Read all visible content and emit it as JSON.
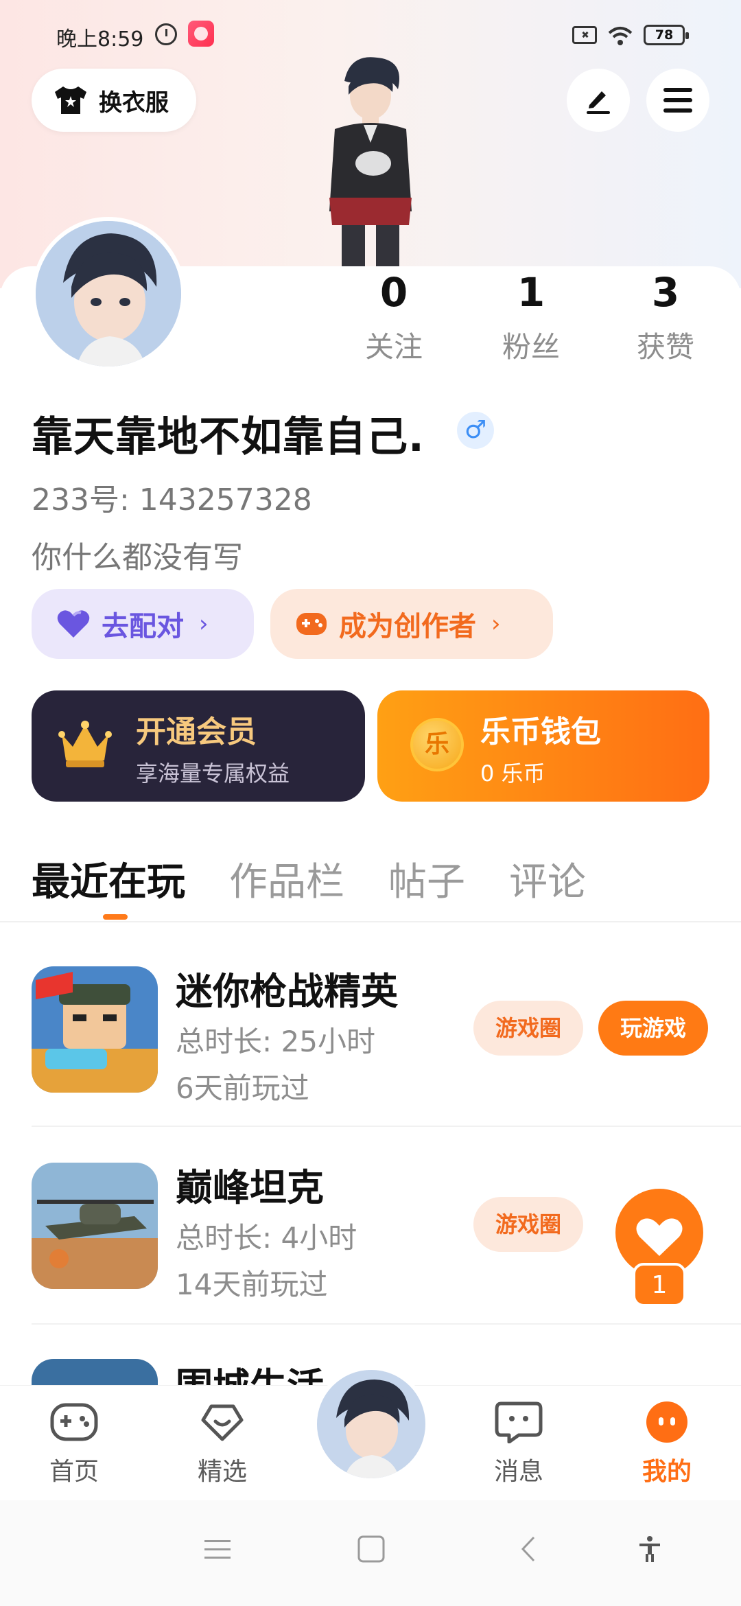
{
  "status_bar": {
    "time": "晚上8:59",
    "battery": "78"
  },
  "header": {
    "outfit_label": "换衣服"
  },
  "profile": {
    "stats": [
      {
        "value": "0",
        "label": "关注"
      },
      {
        "value": "1",
        "label": "粉丝"
      },
      {
        "value": "3",
        "label": "获赞"
      }
    ],
    "username": "靠天靠地不如靠自己.",
    "gender_symbol": "♂",
    "uid": "233号: 143257328",
    "bio": "你什么都没有写"
  },
  "pills": {
    "match": "去配对",
    "creator": "成为创作者",
    "chevron": "›"
  },
  "cards": {
    "vip": {
      "title": "开通会员",
      "subtitle": "享海量专属权益"
    },
    "wallet": {
      "title": "乐币钱包",
      "subtitle": "0 乐币",
      "coin_glyph": "乐"
    }
  },
  "tabs": [
    "最近在玩",
    "作品栏",
    "帖子",
    "评论"
  ],
  "games": [
    {
      "name": "迷你枪战精英",
      "duration": "总时长: 25小时",
      "last_played": "6天前玩过",
      "circle_label": "游戏圈",
      "play_label": "玩游戏"
    },
    {
      "name": "巅峰坦克",
      "duration": "总时长: 4小时",
      "last_played": "14天前玩过",
      "circle_label": "游戏圈"
    },
    {
      "name": "围城生活"
    }
  ],
  "like_badge": {
    "count": "1"
  },
  "bottom_nav": [
    {
      "label": "首页"
    },
    {
      "label": "精选"
    },
    {
      "label": "消息"
    },
    {
      "label": "我的"
    }
  ],
  "colors": {
    "accent": "#ff7a14",
    "vip_bg": "#28243a",
    "match": "#6a56e0"
  }
}
